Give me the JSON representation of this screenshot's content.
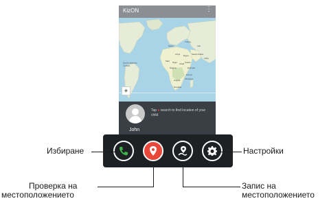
{
  "app": {
    "title": "KizON",
    "menu_icon": "⋮"
  },
  "map": {
    "ocean_label": "North Atlantic Ocean",
    "places": [
      "Spain",
      "Libya",
      "Egypt",
      "Mali",
      "Niger",
      "Chad",
      "Sudan",
      "Nigeria",
      "Ethiopia",
      "Kenya",
      "Angola",
      "Namibia",
      "Tanzania",
      "Saudi Arabia",
      "Iran",
      "India",
      "Turkey"
    ]
  },
  "info": {
    "hint_prefix": "Tap",
    "hint_rest": "search to find location of your child",
    "child_name": "John"
  },
  "actions": [
    {
      "icon": "phone-icon",
      "color": "#3cb64a"
    },
    {
      "icon": "location-pin-icon",
      "color": "#e8473a"
    },
    {
      "icon": "route-pin-icon",
      "color": "#ffffff"
    },
    {
      "icon": "gear-icon",
      "color": "#ffffff"
    }
  ],
  "callouts": {
    "dial": "Избиране",
    "check_location_line1": "Проверка на",
    "check_location_line2": "местоположението",
    "settings": "Настройки",
    "record_location_line1": "Запис на",
    "record_location_line2": "местоположението"
  }
}
